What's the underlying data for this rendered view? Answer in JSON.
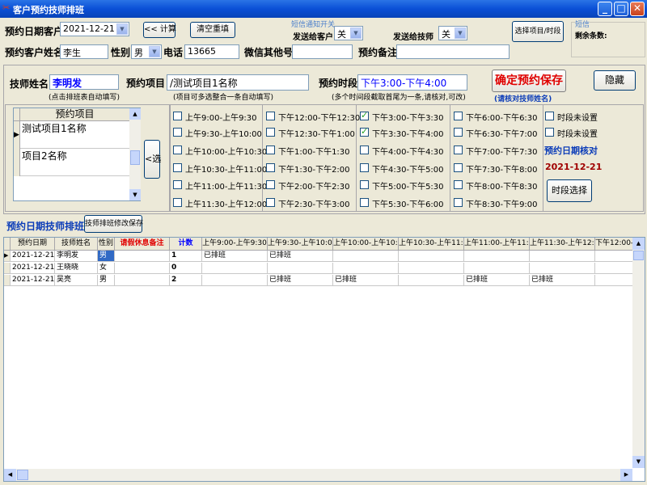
{
  "window": {
    "title": "客户预约技师排班"
  },
  "top": {
    "date_label": "预约日期客户",
    "date_value": "2021-12-21",
    "calc_button": "<< 计算",
    "clear_button": "清空重填",
    "sms_switch_title": "短信通知开关",
    "send_customer_label": "发送给客户",
    "send_customer_value": "关",
    "send_tech_label": "发送给技师",
    "send_tech_value": "关",
    "select_item_button": "选择项目/时段",
    "sms_title": "短信",
    "remain_label": "剩余条数:",
    "name_label": "预约客户姓名",
    "name_value": "李生",
    "gender_label": "性别",
    "gender_value": "男",
    "phone_label": "电话",
    "phone_value": "13665",
    "wechat_label": "微信其他号",
    "wechat_value": "",
    "note_label": "预约备注",
    "note_value": ""
  },
  "booking": {
    "tech_label": "技师姓名",
    "tech_value": "李明发",
    "tech_hint": "(点击排班表自动填写)",
    "item_label": "预约项目",
    "item_value": "/测试项目1名称",
    "item_hint": "(项目可多选整合一条自动填写)",
    "slot_label": "预约时段",
    "slot_value": "下午3:00-下午4:00",
    "slot_hint": "(多个时间段截取首尾为一条,请核对,可改)",
    "confirm_button": "确定预约保存",
    "confirm_hint": "(请核对技师姓名)",
    "hide_button": "隐藏"
  },
  "items_list": {
    "header": "预约项目",
    "rows": [
      "测试项目1名称",
      "项目2名称"
    ],
    "select_button": "<选"
  },
  "slots": {
    "col1": [
      {
        "label": "上午9:00-上午9:30",
        "checked": false
      },
      {
        "label": "上午9:30-上午10:00",
        "checked": false
      },
      {
        "label": "上午10:00-上午10:30",
        "checked": false
      },
      {
        "label": "上午10:30-上午11:00",
        "checked": false
      },
      {
        "label": "上午11:00-上午11:30",
        "checked": false
      },
      {
        "label": "上午11:30-上午12:00",
        "checked": false
      }
    ],
    "col2": [
      {
        "label": "下午12:00-下午12:30",
        "checked": false
      },
      {
        "label": "下午12:30-下午1:00",
        "checked": false
      },
      {
        "label": "下午1:00-下午1:30",
        "checked": false
      },
      {
        "label": "下午1:30-下午2:00",
        "checked": false
      },
      {
        "label": "下午2:00-下午2:30",
        "checked": false
      },
      {
        "label": "下午2:30-下午3:00",
        "checked": false
      }
    ],
    "col3": [
      {
        "label": "下午3:00-下午3:30",
        "checked": true
      },
      {
        "label": "下午3:30-下午4:00",
        "checked": true
      },
      {
        "label": "下午4:00-下午4:30",
        "checked": false
      },
      {
        "label": "下午4:30-下午5:00",
        "checked": false
      },
      {
        "label": "下午5:00-下午5:30",
        "checked": false
      },
      {
        "label": "下午5:30-下午6:00",
        "checked": false
      }
    ],
    "col4": [
      {
        "label": "下午6:00-下午6:30",
        "checked": false
      },
      {
        "label": "下午6:30-下午7:00",
        "checked": false
      },
      {
        "label": "下午7:00-下午7:30",
        "checked": false
      },
      {
        "label": "下午7:30-下午8:00",
        "checked": false
      },
      {
        "label": "下午8:00-下午8:30",
        "checked": false
      },
      {
        "label": "下午8:30-下午9:00",
        "checked": false
      }
    ],
    "col5": [
      {
        "label": "时段未设置",
        "checked": false
      },
      {
        "label": "时段未设置",
        "checked": false
      }
    ],
    "verify_label": "预约日期核对",
    "verify_date": "2021-12-21",
    "slot_select_button": "时段选择"
  },
  "schedule": {
    "title": "预约日期技师排班",
    "save_button": "技师排班修改保存",
    "columns": [
      "预约日期",
      "技师姓名",
      "性别",
      "请假休息备注",
      "计数",
      "上午9:00-上午9:30",
      "上午9:30-上午10:00",
      "上午10:00-上午10:30",
      "上午10:30-上午11:00",
      "上午11:00-上午11:30",
      "上午11:30-上午12:00",
      "下午12:00-下午12"
    ],
    "rows": [
      [
        "2021-12-21",
        "李明发",
        "男",
        "",
        "1",
        "已排班",
        "已排班",
        "",
        "",
        "",
        "",
        ""
      ],
      [
        "2021-12-21",
        "王晓晓",
        "女",
        "",
        "0",
        "",
        "",
        "",
        "",
        "",
        "",
        ""
      ],
      [
        "2021-12-21",
        "吴亮",
        "男",
        "",
        "2",
        "",
        "已排班",
        "已排班",
        "",
        "已排班",
        "已排班",
        ""
      ]
    ]
  },
  "colors": {
    "accent_blue": "#0000ff",
    "red": "#e00000",
    "dark_red": "#a00000",
    "title_blue": "#0a4fd6"
  }
}
